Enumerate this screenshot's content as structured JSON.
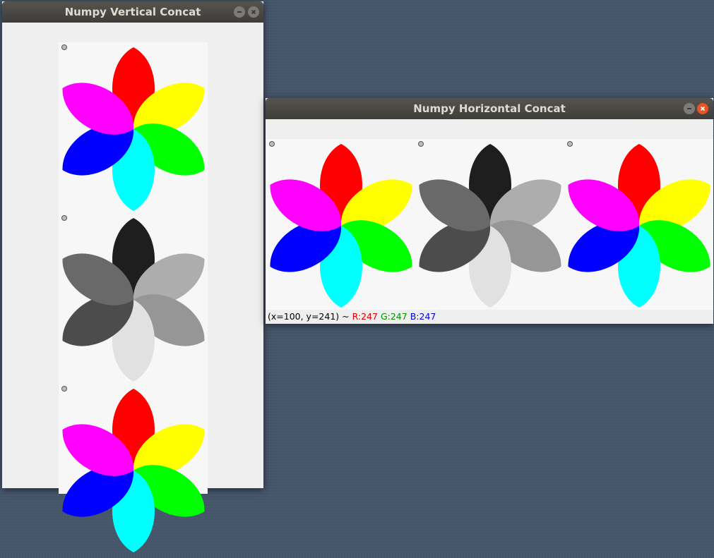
{
  "vertical_window": {
    "title": "Numpy Vertical Concat",
    "minimize_icon": "minimize-icon",
    "close_icon": "close-icon"
  },
  "horizontal_window": {
    "title": "Numpy Horizontal Concat",
    "minimize_icon": "minimize-icon",
    "close_icon": "close-icon",
    "status": {
      "coords": "(x=100, y=241) ~",
      "r": "R:247",
      "g": "G:247",
      "b": "B:247",
      "r_color": "#e00000",
      "g_color": "#009000",
      "b_color": "#0000e0"
    }
  },
  "images": {
    "color_petals": [
      "#ff0000",
      "#ffff00",
      "#00ff00",
      "#00ffff",
      "#0000ff",
      "#ff00ff"
    ],
    "gray_petals": [
      "#1e1e1e",
      "#adadad",
      "#969696",
      "#e1e1e1",
      "#4c4c4c",
      "#696969"
    ]
  }
}
